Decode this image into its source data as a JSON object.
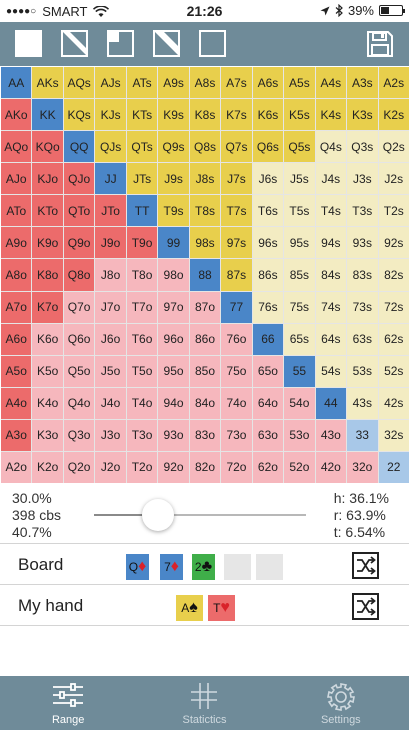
{
  "status_bar": {
    "carrier": "SMART",
    "time": "21:26",
    "battery": "39%",
    "battery_level": 0.39,
    "icons": [
      "signal-dots-icon",
      "wifi-icon",
      "location-icon",
      "bluetooth-icon",
      "battery-icon"
    ]
  },
  "toolbar": {
    "buttons": [
      "select-all-icon",
      "select-suited-icon",
      "select-pairs-icon",
      "select-offsuit-icon",
      "clear-selection-icon"
    ],
    "save_icon": "save-icon"
  },
  "grid": {
    "rows": [
      [
        "AA",
        "AKs",
        "AQs",
        "AJs",
        "ATs",
        "A9s",
        "A8s",
        "A7s",
        "A6s",
        "A5s",
        "A4s",
        "A3s",
        "A2s"
      ],
      [
        "AKo",
        "KK",
        "KQs",
        "KJs",
        "KTs",
        "K9s",
        "K8s",
        "K7s",
        "K6s",
        "K5s",
        "K4s",
        "K3s",
        "K2s"
      ],
      [
        "AQo",
        "KQo",
        "QQ",
        "QJs",
        "QTs",
        "Q9s",
        "Q8s",
        "Q7s",
        "Q6s",
        "Q5s",
        "Q4s",
        "Q3s",
        "Q2s"
      ],
      [
        "AJo",
        "KJo",
        "QJo",
        "JJ",
        "JTs",
        "J9s",
        "J8s",
        "J7s",
        "J6s",
        "J5s",
        "J4s",
        "J3s",
        "J2s"
      ],
      [
        "ATo",
        "KTo",
        "QTo",
        "JTo",
        "TT",
        "T9s",
        "T8s",
        "T7s",
        "T6s",
        "T5s",
        "T4s",
        "T3s",
        "T2s"
      ],
      [
        "A9o",
        "K9o",
        "Q9o",
        "J9o",
        "T9o",
        "99",
        "98s",
        "97s",
        "96s",
        "95s",
        "94s",
        "93s",
        "92s"
      ],
      [
        "A8o",
        "K8o",
        "Q8o",
        "J8o",
        "T8o",
        "98o",
        "88",
        "87s",
        "86s",
        "85s",
        "84s",
        "83s",
        "82s"
      ],
      [
        "A7o",
        "K7o",
        "Q7o",
        "J7o",
        "T7o",
        "97o",
        "87o",
        "77",
        "76s",
        "75s",
        "74s",
        "73s",
        "72s"
      ],
      [
        "A6o",
        "K6o",
        "Q6o",
        "J6o",
        "T6o",
        "96o",
        "86o",
        "76o",
        "66",
        "65s",
        "64s",
        "63s",
        "62s"
      ],
      [
        "A5o",
        "K5o",
        "Q5o",
        "J5o",
        "T5o",
        "95o",
        "85o",
        "75o",
        "65o",
        "55",
        "54s",
        "53s",
        "52s"
      ],
      [
        "A4o",
        "K4o",
        "Q4o",
        "J4o",
        "T4o",
        "94o",
        "84o",
        "74o",
        "64o",
        "54o",
        "44",
        "43s",
        "42s"
      ],
      [
        "A3o",
        "K3o",
        "Q3o",
        "J3o",
        "T3o",
        "93o",
        "83o",
        "73o",
        "63o",
        "53o",
        "43o",
        "33",
        "32s"
      ],
      [
        "A2o",
        "K2o",
        "Q2o",
        "J2o",
        "T2o",
        "92o",
        "82o",
        "72o",
        "62o",
        "52o",
        "42o",
        "32o",
        "22"
      ]
    ],
    "selected": [
      [
        "AA",
        "AKs",
        "AQs",
        "AJs",
        "ATs",
        "A9s",
        "A8s",
        "A7s",
        "A6s",
        "A5s",
        "A4s",
        "A3s",
        "A2s"
      ],
      [
        "AKo",
        "KK",
        "KQs",
        "KJs",
        "KTs",
        "K9s",
        "K8s",
        "K7s",
        "K6s",
        "K5s",
        "K4s",
        "K3s",
        "K2s"
      ],
      [
        "AQo",
        "KQo",
        "QQ",
        "QJs",
        "QTs",
        "Q9s",
        "Q8s",
        "Q7s",
        "Q6s",
        "Q5s"
      ],
      [
        "AJo",
        "KJo",
        "QJo",
        "JJ",
        "JTs",
        "J9s",
        "J8s",
        "J7s"
      ],
      [
        "ATo",
        "KTo",
        "QTo",
        "JTo",
        "TT",
        "T9s",
        "T8s",
        "T7s"
      ],
      [
        "A9o",
        "K9o",
        "Q9o",
        "J9o",
        "T9o",
        "99",
        "98s",
        "97s"
      ],
      [
        "A8o",
        "K8o",
        "Q8o",
        "88",
        "87s"
      ],
      [
        "A7o",
        "K7o",
        "77"
      ],
      [
        "A6o",
        "66"
      ],
      [
        "A5o",
        "55"
      ],
      [
        "A4o",
        "44"
      ],
      [
        "A3o"
      ],
      []
    ],
    "colors": {
      "pair_selected": "#4a86c8",
      "pair_unselected": "#a8c8e8",
      "suited_selected": "#e8cf4c",
      "suited_unselected": "#f3ecc2",
      "offsuit_selected": "#ec6b6b",
      "offsuit_unselected": "#f6b7bd"
    }
  },
  "stats": {
    "range_percent": "30.0%",
    "combos": "398 cbs",
    "secondary_percent": "40.7%",
    "slider_value": 0.3,
    "h": "h: 36.1%",
    "r": "r: 63.9%",
    "t": "t: 6.54%"
  },
  "board": {
    "label": "Board",
    "cards": [
      {
        "rank": "Q",
        "suit": "♦",
        "suit_color": "#d9222a",
        "bg": "#4a86c8"
      },
      {
        "rank": "7",
        "suit": "♦",
        "suit_color": "#d9222a",
        "bg": "#4a86c8"
      },
      {
        "rank": "2",
        "suit": "♣",
        "suit_color": "#111111",
        "bg": "#3fae49"
      }
    ],
    "empty_slots": 2,
    "shuffle_icon": "shuffle-icon"
  },
  "my_hand": {
    "label": "My hand",
    "cards": [
      {
        "rank": "A",
        "suit": "♠",
        "suit_color": "#111111",
        "bg": "#e8cf4c"
      },
      {
        "rank": "T",
        "suit": "♥",
        "suit_color": "#d9222a",
        "bg": "#ec6b6b"
      }
    ],
    "shuffle_icon": "shuffle-icon"
  },
  "tabs": [
    {
      "label": "Range",
      "icon": "sliders-icon",
      "active": true
    },
    {
      "label": "Statictics",
      "icon": "grid-icon",
      "active": false
    },
    {
      "label": "Settings",
      "icon": "gear-icon",
      "active": false
    }
  ]
}
